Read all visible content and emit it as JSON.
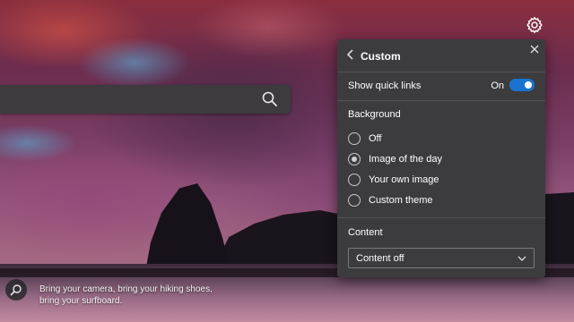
{
  "search": {
    "icon": "search-icon"
  },
  "settings": {
    "icon": "gear-icon"
  },
  "panel": {
    "title": "Custom",
    "quick_links": {
      "label": "Show quick links",
      "state_label": "On",
      "enabled": true
    },
    "background": {
      "label": "Background",
      "options": [
        "Off",
        "Image of the day",
        "Your own image",
        "Custom theme"
      ],
      "selected": "Image of the day"
    },
    "content": {
      "label": "Content",
      "selected_value": "Content off"
    }
  },
  "caption": {
    "text": "Bring your camera, bring your hiking shoes, bring your surfboard."
  },
  "colors": {
    "panel_bg": "#3c3c3e",
    "toggle_on": "#1a73d1"
  }
}
